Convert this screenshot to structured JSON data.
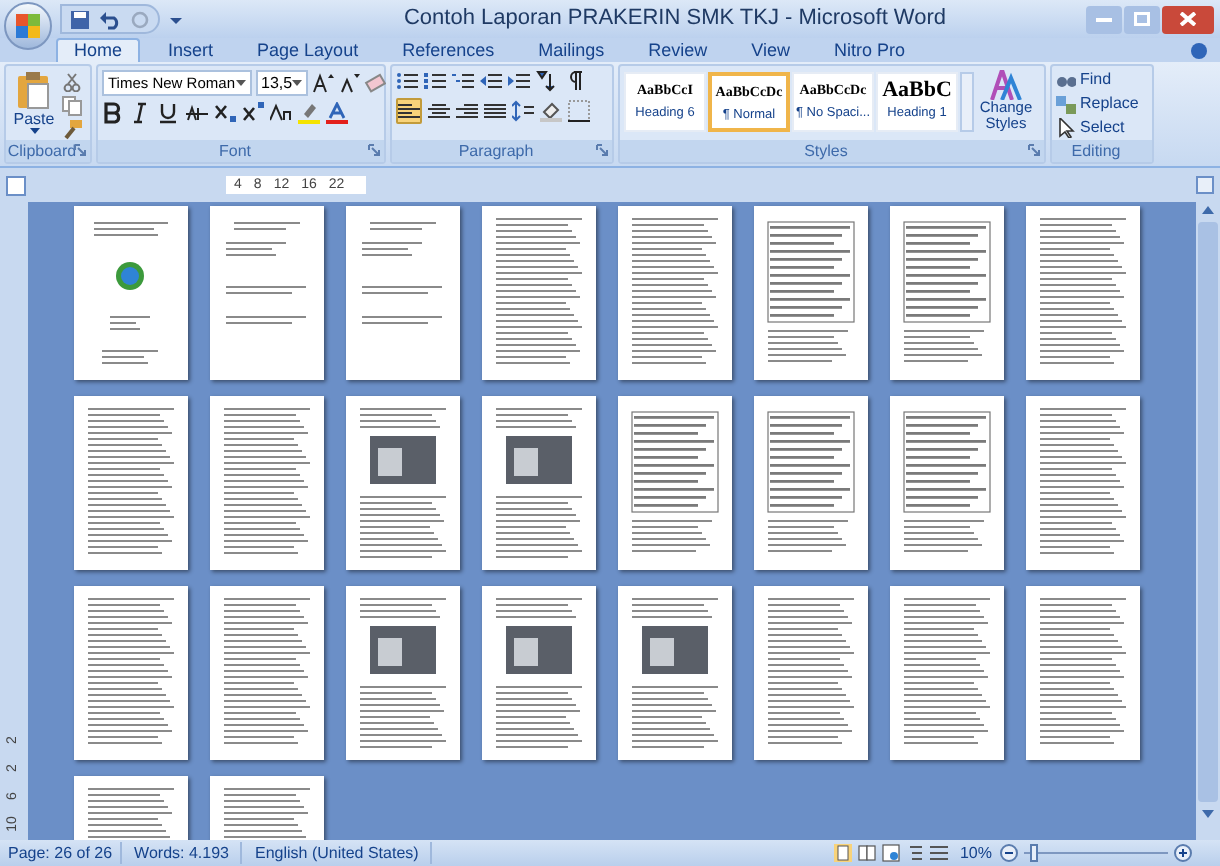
{
  "window": {
    "title": "Contoh Laporan PRAKERIN SMK TKJ - Microsoft Word"
  },
  "tabs": [
    {
      "label": "Home",
      "selected": true
    },
    {
      "label": "Insert",
      "selected": false
    },
    {
      "label": "Page Layout",
      "selected": false
    },
    {
      "label": "References",
      "selected": false
    },
    {
      "label": "Mailings",
      "selected": false
    },
    {
      "label": "Review",
      "selected": false
    },
    {
      "label": "View",
      "selected": false
    },
    {
      "label": "Nitro Pro",
      "selected": false
    }
  ],
  "ribbon": {
    "clipboard": {
      "paste": "Paste",
      "label": "Clipboard"
    },
    "font": {
      "name": "Times New Roman",
      "size": "13,5",
      "label": "Font"
    },
    "paragraph": {
      "label": "Paragraph"
    },
    "styles": {
      "items": [
        {
          "sample": "AaBbCcI",
          "name": "Heading 6",
          "selected": false
        },
        {
          "sample": "AaBbCcDc",
          "name": "¶ Normal",
          "selected": true
        },
        {
          "sample": "AaBbCcDc",
          "name": "¶ No Spaci...",
          "selected": false
        },
        {
          "sample": "AaBbC",
          "name": "Heading 1",
          "selected": false
        }
      ],
      "change_styles": "Change Styles",
      "label": "Styles"
    },
    "editing": {
      "find": "Find",
      "replace": "Replace",
      "select": "Select",
      "label": "Editing"
    }
  },
  "ruler": {
    "ticks": [
      "4",
      "8",
      "12",
      "16",
      "22"
    ]
  },
  "vertical_ruler": {
    "ticks": [
      "2",
      "2",
      "6",
      "10"
    ]
  },
  "pages": [
    {
      "kind": "cover"
    },
    {
      "kind": "form"
    },
    {
      "kind": "form"
    },
    {
      "kind": "text"
    },
    {
      "kind": "text"
    },
    {
      "kind": "table"
    },
    {
      "kind": "table"
    },
    {
      "kind": "text"
    },
    {
      "kind": "text"
    },
    {
      "kind": "text"
    },
    {
      "kind": "photo"
    },
    {
      "kind": "photo"
    },
    {
      "kind": "table"
    },
    {
      "kind": "table"
    },
    {
      "kind": "table"
    },
    {
      "kind": "text"
    },
    {
      "kind": "text"
    },
    {
      "kind": "text"
    },
    {
      "kind": "photo"
    },
    {
      "kind": "photo"
    },
    {
      "kind": "photo"
    },
    {
      "kind": "text"
    },
    {
      "kind": "text"
    },
    {
      "kind": "text"
    },
    {
      "kind": "text"
    },
    {
      "kind": "text"
    }
  ],
  "status_bar": {
    "page": "Page: 26 of 26",
    "words": "Words: 4.193",
    "language": "English (United States)",
    "zoom": "10%",
    "zoom_level": {
      "level": 0.05
    }
  }
}
